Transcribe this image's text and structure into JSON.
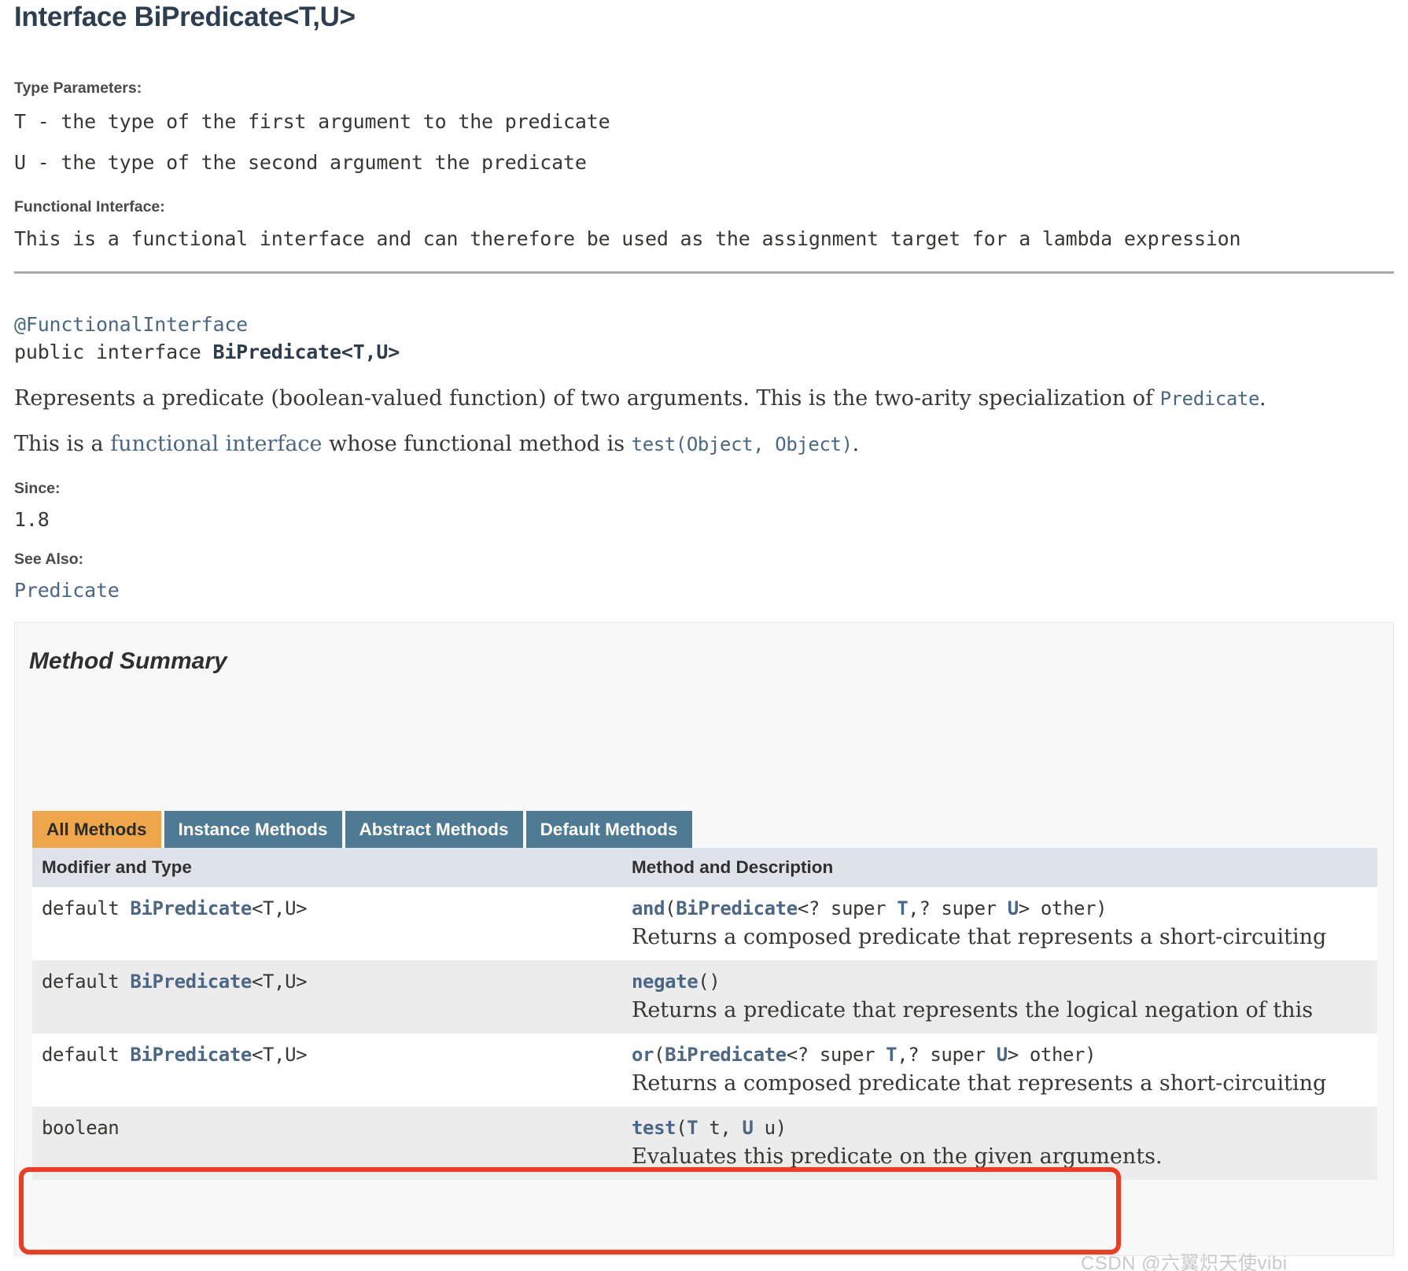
{
  "page": {
    "title": "Interface BiPredicate<T,U>"
  },
  "type_parameters": {
    "label": "Type Parameters:",
    "items": [
      "T - the type of the first argument to the predicate",
      "U - the type of the second argument the predicate"
    ]
  },
  "functional_interface": {
    "label": "Functional Interface:",
    "text": "This is a functional interface and can therefore be used as the assignment target for a lambda expression"
  },
  "declaration": {
    "annotation": "@FunctionalInterface",
    "modifiers": "public interface ",
    "name": "BiPredicate<T,U>"
  },
  "description": {
    "para1_before": "Represents a predicate (boolean-valued function) of two arguments. This is the two-arity specialization of ",
    "para1_link": "Predicate",
    "para1_after": ".",
    "para2_before": "This is a ",
    "para2_link1": "functional interface",
    "para2_mid": " whose functional method is ",
    "para2_link2": "test(Object, Object)",
    "para2_after": "."
  },
  "since": {
    "label": "Since:",
    "value": "1.8"
  },
  "see_also": {
    "label": "See Also:",
    "link": "Predicate"
  },
  "method_summary": {
    "heading": "Method Summary",
    "tabs": [
      {
        "label": "All Methods",
        "active": true
      },
      {
        "label": "Instance Methods",
        "active": false
      },
      {
        "label": "Abstract Methods",
        "active": false
      },
      {
        "label": "Default Methods",
        "active": false
      }
    ],
    "columns": {
      "type": "Modifier and Type",
      "method": "Method and Description"
    },
    "rows": [
      {
        "modifier": "default ",
        "type_link": "BiPredicate",
        "type_suffix": "<T,U>",
        "method_name": "and",
        "sig_open": "(",
        "sig_link": "BiPredicate",
        "sig_part1": "<? super ",
        "sig_tp1": "T",
        "sig_part2": ",? super ",
        "sig_tp2": "U",
        "sig_part3": "> other)",
        "description": "Returns a composed predicate that represents a short-circuiting",
        "alt": false,
        "highlighted": false
      },
      {
        "modifier": "default ",
        "type_link": "BiPredicate",
        "type_suffix": "<T,U>",
        "method_name": "negate",
        "sig_open": "(",
        "sig_link": "",
        "sig_part1": "",
        "sig_tp1": "",
        "sig_part2": "",
        "sig_tp2": "",
        "sig_part3": ")",
        "description": "Returns a predicate that represents the logical negation of this",
        "alt": true,
        "highlighted": false
      },
      {
        "modifier": "default ",
        "type_link": "BiPredicate",
        "type_suffix": "<T,U>",
        "method_name": "or",
        "sig_open": "(",
        "sig_link": "BiPredicate",
        "sig_part1": "<? super ",
        "sig_tp1": "T",
        "sig_part2": ",? super ",
        "sig_tp2": "U",
        "sig_part3": "> other)",
        "description": "Returns a composed predicate that represents a short-circuiting",
        "alt": false,
        "highlighted": false
      },
      {
        "modifier": "boolean",
        "type_link": "",
        "type_suffix": "",
        "method_name": "test",
        "sig_open": "(",
        "sig_link": "",
        "sig_part1": "",
        "sig_tp1": "T",
        "sig_part2": " t, ",
        "sig_tp2": "U",
        "sig_part3": " u)",
        "description": "Evaluates this predicate on the given arguments.",
        "alt": true,
        "highlighted": true
      }
    ]
  },
  "watermark": "CSDN @六翼炽天使vibi",
  "colors": {
    "title": "#2c3e50",
    "link": "#4a6785",
    "tab_active_bg": "#eda64a",
    "tab_bg": "#4e7a94",
    "table_header_bg": "#dee3e9",
    "highlight_border": "#ef3b20",
    "alt_row_bg": "#ececec"
  }
}
